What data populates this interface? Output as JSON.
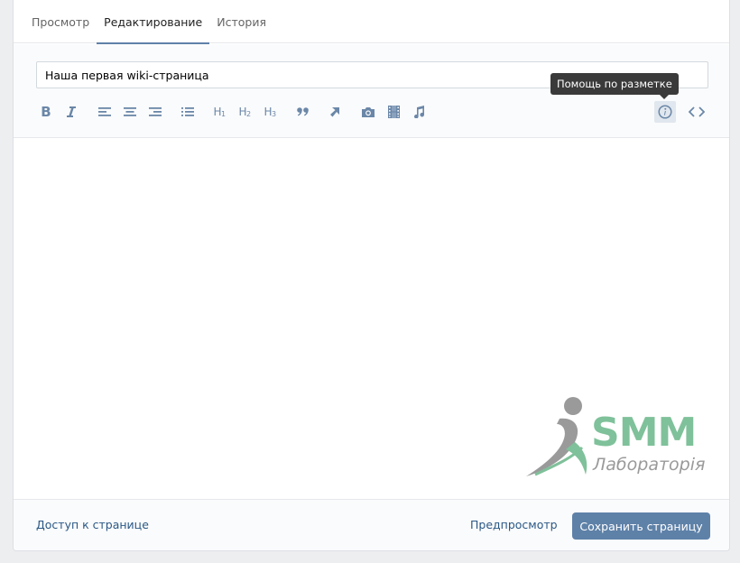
{
  "tabs": [
    {
      "label": "Просмотр",
      "active": false
    },
    {
      "label": "Редактирование",
      "active": true
    },
    {
      "label": "История",
      "active": false
    }
  ],
  "editor": {
    "title_value": "Наша первая wiki-страница",
    "tooltip": "Помощь по разметке",
    "toolbar": {
      "icons": [
        "bold-icon",
        "italic-icon",
        "align-left-icon",
        "align-center-icon",
        "align-right-icon",
        "bulleted-list-icon",
        "heading-1-icon",
        "heading-2-icon",
        "heading-3-icon",
        "quote-icon",
        "link-icon",
        "photo-icon",
        "video-icon",
        "audio-icon",
        "markup-help-icon",
        "code-icon"
      ],
      "h1": "H",
      "h1_sub": "1",
      "h2": "H",
      "h2_sub": "2",
      "h3": "H",
      "h3_sub": "3",
      "bold": "B"
    }
  },
  "watermark": {
    "brand": "SMM",
    "subtitle": "Лабораторія"
  },
  "footer": {
    "access_link": "Доступ к странице",
    "preview_link": "Предпросмотр",
    "save_button": "Сохранить страницу"
  },
  "colors": {
    "accent": "#5e81a8",
    "link": "#2a5885",
    "icon": "#6b87a8",
    "tooltip_bg": "#3a3a3a",
    "watermark_green": "#7fc19a"
  }
}
